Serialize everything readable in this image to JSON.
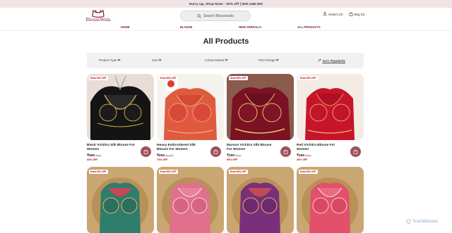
{
  "announcement": "Hurry Up, Shop Now! - 50% Off   |   00H:14M:36S",
  "brand": {
    "name": "BlouseWala"
  },
  "search": {
    "placeholder": "Search Blousewala"
  },
  "header": {
    "orders": "Orders (0)",
    "bag": "Bag (0)"
  },
  "nav": [
    "HOME",
    "BLOUSE",
    "NEW ARRIVALS",
    "ALL PRODUCTS"
  ],
  "page_title": "All Products",
  "filters": {
    "product_type": "Product Type",
    "size": "Size",
    "colour": "Colour/Variant",
    "price": "Price Range",
    "sort": "Sort: Popularity"
  },
  "products": [
    {
      "badge": "Extra 50% OFF",
      "name": "Black Vichitra Silk Blouse For Women",
      "price": "₹569",
      "mrp": "₹849",
      "off": "33% OFF"
    },
    {
      "badge": "Extra 50% OFF",
      "name": "Heavy Embroidered Silk Blouse For Women",
      "price": "₹659",
      "mrp": "₹2,499",
      "off": "74% OFF"
    },
    {
      "badge": "Extra 50% OFF",
      "name": "Maroon Vichitra Silk Blouse For Women",
      "price": "₹359",
      "mrp": "₹719",
      "off": "50% OFF"
    },
    {
      "badge": "Extra 50% OFF",
      "name": "Red Vichitra Blouse For Women",
      "price": "₹369",
      "mrp": "₹549",
      "off": "33% OFF"
    }
  ],
  "products_row2": [
    {
      "badge": "Extra 50% OFF"
    },
    {
      "badge": "Extra 50% OFF"
    },
    {
      "badge": "Extra 50% OFF"
    },
    {
      "badge": "Extra 50% OFF"
    }
  ],
  "watermark": "ScanMalware",
  "colors": {
    "accent": "#7b1f2c",
    "bag_button": "#a0505a",
    "announce_bg": "#f1e4e4"
  }
}
